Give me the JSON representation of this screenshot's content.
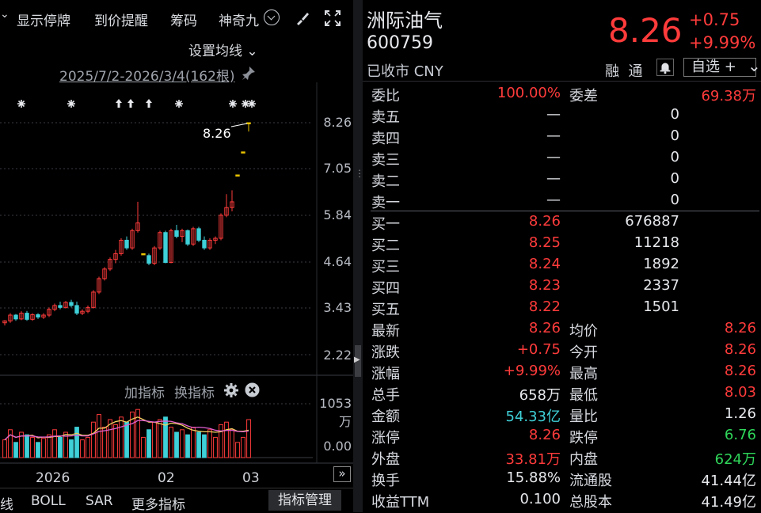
{
  "toolbar": {
    "items": [
      "显示停牌",
      "到价提醒",
      "筹码",
      "神奇九"
    ],
    "brush_icon": "brush-icon",
    "expand_icon": "expand-icon"
  },
  "chart": {
    "settings_label": "设置均线",
    "date_range": "2025/7/2-2026/3/4(162根)",
    "price_labels": [
      "8.26",
      "7.05",
      "5.84",
      "4.64",
      "3.43",
      "2.22"
    ],
    "last_price_label": "8.26",
    "indicator_add": "加指标",
    "indicator_switch": "换指标",
    "volume_labels": [
      "1053万",
      "0.00"
    ],
    "x_labels": [
      "2026",
      "02",
      "03"
    ],
    "bottom_tabs": [
      "线",
      "BOLL",
      "SAR",
      "更多指标"
    ],
    "indicator_manage": "指标管理",
    "colors": {
      "up": "#ff3b3b",
      "down": "#3fd0d8",
      "limit": "#e8c200"
    }
  },
  "chart_data": {
    "type": "candlestick",
    "date_range": "2025/7/2-2026/3/4",
    "ylim": [
      2.22,
      8.26
    ],
    "candles": [
      [
        3.05,
        3.12,
        2.98,
        3.1
      ],
      [
        3.1,
        3.3,
        3.05,
        3.25
      ],
      [
        3.25,
        3.28,
        3.1,
        3.15
      ],
      [
        3.15,
        3.35,
        3.12,
        3.3
      ],
      [
        3.3,
        3.36,
        3.1,
        3.14
      ],
      [
        3.14,
        3.3,
        3.1,
        3.26
      ],
      [
        3.26,
        3.3,
        3.15,
        3.2
      ],
      [
        3.2,
        3.3,
        3.15,
        3.25
      ],
      [
        3.25,
        3.45,
        3.2,
        3.4
      ],
      [
        3.4,
        3.55,
        3.35,
        3.5
      ],
      [
        3.5,
        3.6,
        3.4,
        3.45
      ],
      [
        3.45,
        3.62,
        3.42,
        3.58
      ],
      [
        3.58,
        3.65,
        3.45,
        3.5
      ],
      [
        3.5,
        3.6,
        3.25,
        3.3
      ],
      [
        3.3,
        3.4,
        3.25,
        3.35
      ],
      [
        3.35,
        3.5,
        3.3,
        3.45
      ],
      [
        3.45,
        3.9,
        3.42,
        3.85
      ],
      [
        3.85,
        4.25,
        3.8,
        4.2
      ],
      [
        4.2,
        4.5,
        4.15,
        4.45
      ],
      [
        4.45,
        4.75,
        4.4,
        4.7
      ],
      [
        4.7,
        4.95,
        4.6,
        4.85
      ],
      [
        4.85,
        5.25,
        4.8,
        5.2
      ],
      [
        5.2,
        5.3,
        4.95,
        5.0
      ],
      [
        5.0,
        5.5,
        4.95,
        5.45
      ],
      [
        5.45,
        6.2,
        5.4,
        5.65
      ],
      [
        4.85,
        4.85,
        4.85,
        4.85
      ],
      [
        4.8,
        4.85,
        4.55,
        4.6
      ],
      [
        4.6,
        5.05,
        4.55,
        5.0
      ],
      [
        5.0,
        5.45,
        4.95,
        5.4
      ],
      [
        5.4,
        5.45,
        4.6,
        4.62
      ],
      [
        4.62,
        5.5,
        4.6,
        5.45
      ],
      [
        5.45,
        5.6,
        5.25,
        5.3
      ],
      [
        5.3,
        5.5,
        5.15,
        5.45
      ],
      [
        5.45,
        5.48,
        5.05,
        5.1
      ],
      [
        5.1,
        5.55,
        5.05,
        5.5
      ],
      [
        5.5,
        5.55,
        5.15,
        5.2
      ],
      [
        5.2,
        5.3,
        4.95,
        5.0
      ],
      [
        5.0,
        5.25,
        4.95,
        5.2
      ],
      [
        5.2,
        5.3,
        5.1,
        5.25
      ],
      [
        5.25,
        5.9,
        5.2,
        5.85
      ],
      [
        5.85,
        6.4,
        5.8,
        6.05
      ],
      [
        6.05,
        6.5,
        5.95,
        6.2
      ],
      [
        6.9,
        6.9,
        6.9,
        6.9
      ],
      [
        7.5,
        7.5,
        7.5,
        7.5
      ],
      [
        8.26,
        8.26,
        8.03,
        8.26
      ]
    ],
    "volume": {
      "ylim": [
        0,
        1053
      ],
      "unit": "万"
    },
    "x_ticks": [
      "2026",
      "02",
      "03"
    ]
  },
  "quote": {
    "name": "洲际油气",
    "code": "600759",
    "status": "已收市 CNY",
    "price": "8.26",
    "change": "+0.75",
    "change_pct": "+9.99%",
    "rong": "融",
    "tong": "通",
    "watch_label": "自选 +",
    "weibi_label": "委比",
    "weibi": "100.00%",
    "weicha_label": "委差",
    "weicha": "69.38万",
    "asks": [
      {
        "label": "卖五",
        "price": "—",
        "vol": "0"
      },
      {
        "label": "卖四",
        "price": "—",
        "vol": "0"
      },
      {
        "label": "卖三",
        "price": "—",
        "vol": "0"
      },
      {
        "label": "卖二",
        "price": "—",
        "vol": "0"
      },
      {
        "label": "卖一",
        "price": "—",
        "vol": "0"
      }
    ],
    "bids": [
      {
        "label": "买一",
        "price": "8.26",
        "vol": "676887"
      },
      {
        "label": "买二",
        "price": "8.25",
        "vol": "11218"
      },
      {
        "label": "买三",
        "price": "8.24",
        "vol": "1892"
      },
      {
        "label": "买四",
        "price": "8.23",
        "vol": "2337"
      },
      {
        "label": "买五",
        "price": "8.22",
        "vol": "1501"
      }
    ],
    "stats": [
      {
        "l1": "最新",
        "v1": "8.26",
        "k1": "red",
        "l2": "均价",
        "v2": "8.26",
        "k2": "red"
      },
      {
        "l1": "涨跌",
        "v1": "+0.75",
        "k1": "red",
        "l2": "今开",
        "v2": "8.26",
        "k2": "red"
      },
      {
        "l1": "涨幅",
        "v1": "+9.99%",
        "k1": "red",
        "l2": "最高",
        "v2": "8.26",
        "k2": "red"
      },
      {
        "l1": "总手",
        "v1": "658万",
        "k1": "white",
        "l2": "最低",
        "v2": "8.03",
        "k2": "red"
      },
      {
        "l1": "金额",
        "v1": "54.33亿",
        "k1": "cyan",
        "l2": "量比",
        "v2": "1.26",
        "k2": "white"
      },
      {
        "l1": "涨停",
        "v1": "8.26",
        "k1": "red",
        "l2": "跌停",
        "v2": "6.76",
        "k2": "green"
      },
      {
        "l1": "外盘",
        "v1": "33.81万",
        "k1": "red",
        "l2": "内盘",
        "v2": "624万",
        "k2": "green"
      },
      {
        "l1": "换手",
        "v1": "15.88%",
        "k1": "white",
        "l2": "流通股",
        "v2": "41.44亿",
        "k2": "white"
      },
      {
        "l1": "收益TTM",
        "v1": "0.100",
        "k1": "white",
        "l2": "总股本",
        "v2": "41.49亿",
        "k2": "white"
      }
    ]
  }
}
